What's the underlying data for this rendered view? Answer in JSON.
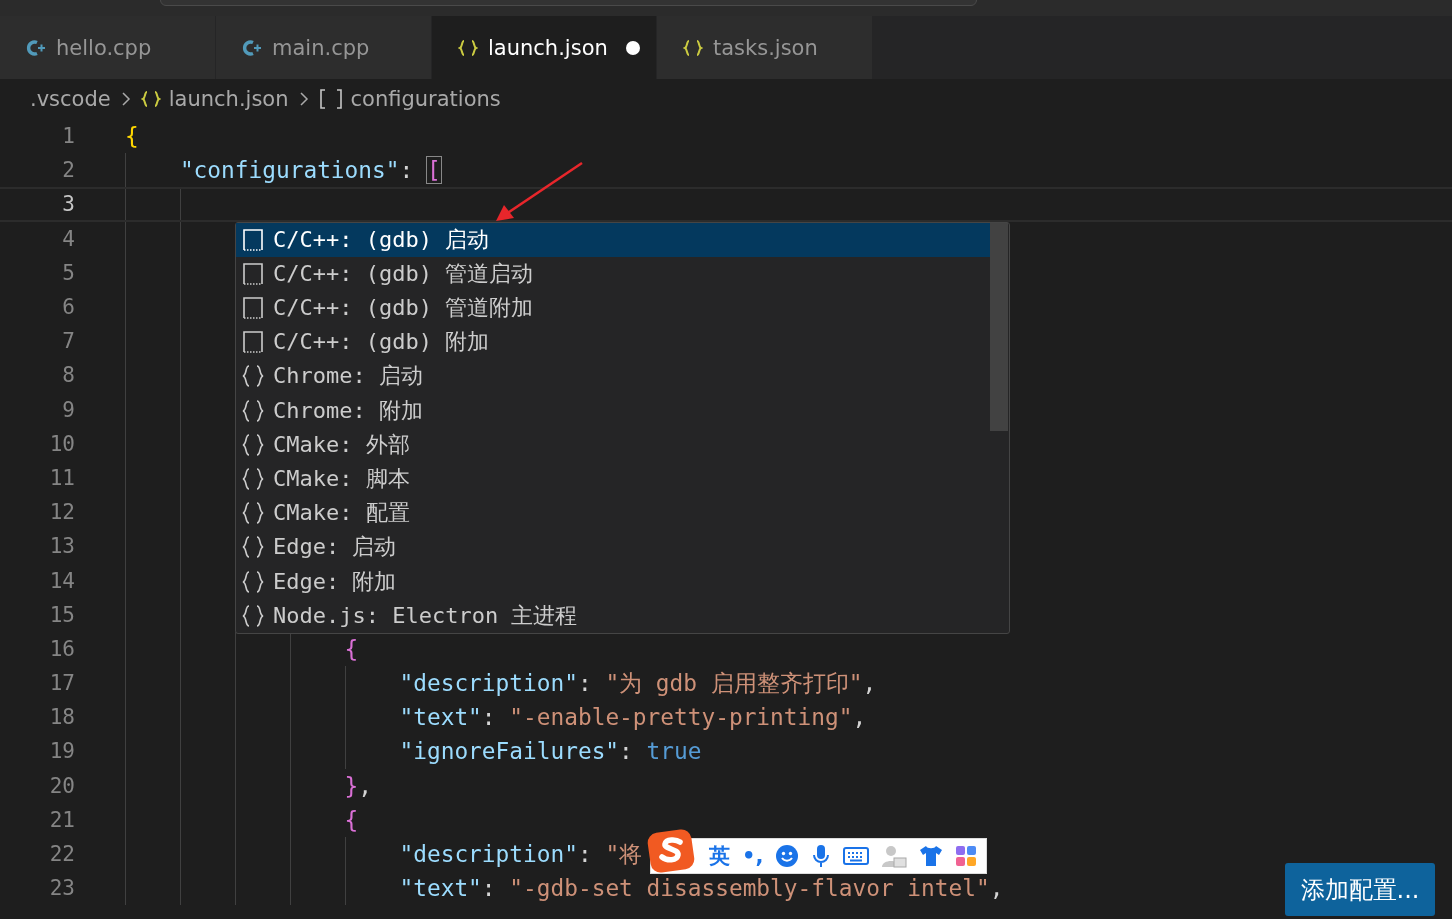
{
  "tabs": [
    {
      "label": "hello.cpp",
      "kind": "cpp",
      "selected": false,
      "modified": false
    },
    {
      "label": "main.cpp",
      "kind": "cpp",
      "selected": false,
      "modified": false
    },
    {
      "label": "launch.json",
      "kind": "json",
      "selected": true,
      "modified": true
    },
    {
      "label": "tasks.json",
      "kind": "json",
      "selected": false,
      "modified": false
    }
  ],
  "breadcrumb": [
    {
      "label": ".vscode",
      "kind": "folder"
    },
    {
      "label": "launch.json",
      "kind": "json"
    },
    {
      "label": "configurations",
      "kind": "array"
    }
  ],
  "editor": {
    "lines": [
      {
        "number": "1",
        "current": false,
        "tokens": [
          {
            "kind": "brace1",
            "text": "{"
          }
        ]
      },
      {
        "number": "2",
        "current": false,
        "tokens": [
          {
            "kind": "key",
            "text": "    \"configurations\""
          },
          {
            "kind": "punct",
            "text": ": "
          },
          {
            "kind": "bracket_matched",
            "text": "["
          }
        ]
      },
      {
        "number": "3",
        "current": true
      },
      {
        "number": "4",
        "current": false
      },
      {
        "number": "5",
        "current": false
      },
      {
        "number": "6",
        "current": false
      },
      {
        "number": "7",
        "current": false
      },
      {
        "number": "8",
        "current": false
      },
      {
        "number": "9",
        "current": false
      },
      {
        "number": "10",
        "current": false
      },
      {
        "number": "11",
        "current": false
      },
      {
        "number": "12",
        "current": false
      },
      {
        "number": "13",
        "current": false
      },
      {
        "number": "14",
        "current": false
      },
      {
        "number": "15",
        "current": false
      },
      {
        "number": "16",
        "current": false,
        "tokens": [
          {
            "kind": "brace2",
            "text": "                {"
          }
        ]
      },
      {
        "number": "17",
        "current": false,
        "tokens": [
          {
            "kind": "key",
            "text": "                    \"description\""
          },
          {
            "kind": "punct",
            "text": ": "
          },
          {
            "kind": "string",
            "text": "\"为 gdb 启用整齐打印\""
          },
          {
            "kind": "punct",
            "text": ","
          }
        ]
      },
      {
        "number": "18",
        "current": false,
        "tokens": [
          {
            "kind": "key",
            "text": "                    \"text\""
          },
          {
            "kind": "punct",
            "text": ": "
          },
          {
            "kind": "string",
            "text": "\"-enable-pretty-printing\""
          },
          {
            "kind": "punct",
            "text": ","
          }
        ]
      },
      {
        "number": "19",
        "current": false,
        "tokens": [
          {
            "kind": "key",
            "text": "                    \"ignoreFailures\""
          },
          {
            "kind": "punct",
            "text": ": "
          },
          {
            "kind": "bool",
            "text": "true"
          }
        ]
      },
      {
        "number": "20",
        "current": false,
        "tokens": [
          {
            "kind": "brace2",
            "text": "                }"
          },
          {
            "kind": "punct",
            "text": ","
          }
        ]
      },
      {
        "number": "21",
        "current": false,
        "tokens": [
          {
            "kind": "brace2",
            "text": "                {"
          }
        ]
      },
      {
        "number": "22",
        "current": false,
        "tokens": [
          {
            "kind": "key",
            "text": "                    \"description\""
          },
          {
            "kind": "punct",
            "text": ": "
          },
          {
            "kind": "string",
            "text": "\"将"
          }
        ]
      },
      {
        "number": "23",
        "current": false,
        "tokens": [
          {
            "kind": "key",
            "text": "                    \"text\""
          },
          {
            "kind": "punct",
            "text": ": "
          },
          {
            "kind": "string",
            "text": "\"-gdb-set disassembly-flavor intel\""
          },
          {
            "kind": "punct",
            "text": ","
          }
        ]
      }
    ]
  },
  "suggestions": {
    "items": [
      {
        "kind": "snippet",
        "label": "C/C++: (gdb) 启动",
        "selected": true
      },
      {
        "kind": "snippet",
        "label": "C/C++: (gdb) 管道启动",
        "selected": false
      },
      {
        "kind": "snippet",
        "label": "C/C++: (gdb) 管道附加",
        "selected": false
      },
      {
        "kind": "snippet",
        "label": "C/C++: (gdb) 附加",
        "selected": false
      },
      {
        "kind": "object",
        "label": "Chrome: 启动",
        "selected": false
      },
      {
        "kind": "object",
        "label": "Chrome: 附加",
        "selected": false
      },
      {
        "kind": "object",
        "label": "CMake: 外部",
        "selected": false
      },
      {
        "kind": "object",
        "label": "CMake: 脚本",
        "selected": false
      },
      {
        "kind": "object",
        "label": "CMake: 配置",
        "selected": false
      },
      {
        "kind": "object",
        "label": "Edge: 启动",
        "selected": false
      },
      {
        "kind": "object",
        "label": "Edge: 附加",
        "selected": false
      },
      {
        "kind": "object",
        "label": "Node.js: Electron 主进程",
        "selected": false
      }
    ]
  },
  "ime_toolbar": {
    "mode": "英",
    "punctuation": "•,"
  },
  "add_configuration_button": "添加配置..."
}
